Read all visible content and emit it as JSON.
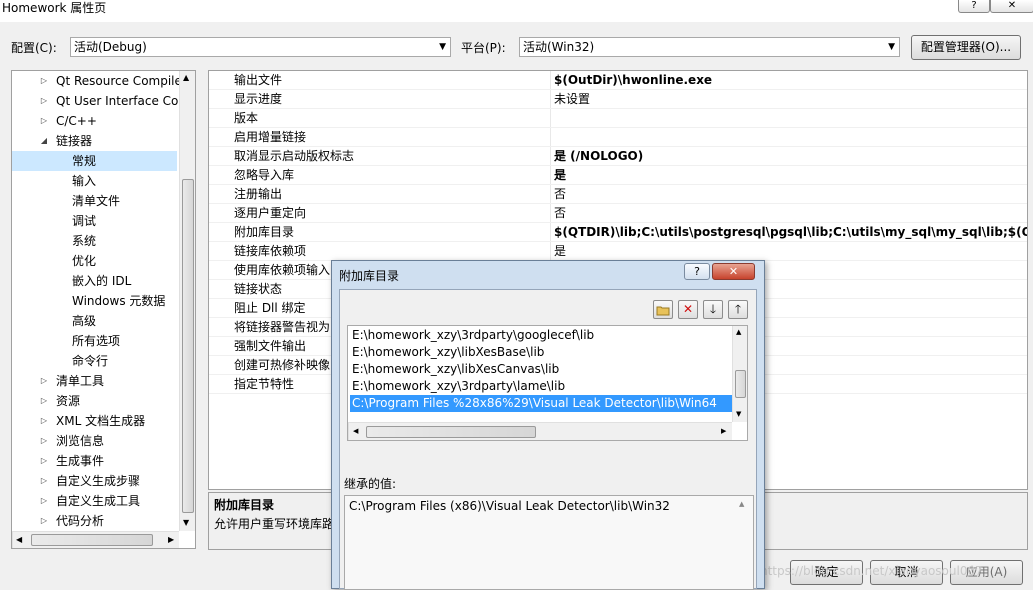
{
  "window": {
    "title": "Homework 属性页",
    "help_label": "?",
    "close_label": "✕"
  },
  "toolbar": {
    "config_label": "配置(C):",
    "config_value": "活动(Debug)",
    "platform_label": "平台(P):",
    "platform_value": "活动(Win32)",
    "config_manager_label": "配置管理器(O)..."
  },
  "tree": {
    "items": [
      {
        "label": "Qt Resource Compile",
        "expander": "▷"
      },
      {
        "label": "Qt User Interface Cor",
        "expander": "▷"
      },
      {
        "label": "C/C++",
        "expander": "▷"
      },
      {
        "label": "链接器",
        "expander": "◢"
      },
      {
        "label": "常规",
        "expander": ""
      },
      {
        "label": "输入",
        "expander": ""
      },
      {
        "label": "清单文件",
        "expander": ""
      },
      {
        "label": "调试",
        "expander": ""
      },
      {
        "label": "系统",
        "expander": ""
      },
      {
        "label": "优化",
        "expander": ""
      },
      {
        "label": "嵌入的 IDL",
        "expander": ""
      },
      {
        "label": "Windows 元数据",
        "expander": ""
      },
      {
        "label": "高级",
        "expander": ""
      },
      {
        "label": "所有选项",
        "expander": ""
      },
      {
        "label": "命令行",
        "expander": ""
      },
      {
        "label": "清单工具",
        "expander": "▷"
      },
      {
        "label": "资源",
        "expander": "▷"
      },
      {
        "label": "XML 文档生成器",
        "expander": "▷"
      },
      {
        "label": "浏览信息",
        "expander": "▷"
      },
      {
        "label": "生成事件",
        "expander": "▷"
      },
      {
        "label": "自定义生成步骤",
        "expander": "▷"
      },
      {
        "label": "自定义生成工具",
        "expander": "▷"
      },
      {
        "label": "代码分析",
        "expander": "▷"
      }
    ]
  },
  "properties": [
    {
      "name": "输出文件",
      "value": "$(OutDir)\\hwonline.exe",
      "bold": true
    },
    {
      "name": "显示进度",
      "value": "未设置",
      "bold": false
    },
    {
      "name": "版本",
      "value": "",
      "bold": false
    },
    {
      "name": "启用增量链接",
      "value": "",
      "bold": false
    },
    {
      "name": "取消显示启动版权标志",
      "value": "是 (/NOLOGO)",
      "bold": true
    },
    {
      "name": "忽略导入库",
      "value": "是",
      "bold": true
    },
    {
      "name": "注册输出",
      "value": "否",
      "bold": false
    },
    {
      "name": "逐用户重定向",
      "value": "否",
      "bold": false
    },
    {
      "name": "附加库目录",
      "value": "$(QTDIR)\\lib;C:\\utils\\postgresql\\pgsql\\lib;C:\\utils\\my_sql\\my_sql\\lib;$(QTD",
      "bold": true
    },
    {
      "name": "链接库依赖项",
      "value": "是",
      "bold": false
    },
    {
      "name": "使用库依赖项输入",
      "value": "",
      "bold": false
    },
    {
      "name": "链接状态",
      "value": "",
      "bold": false
    },
    {
      "name": "阻止 Dll 绑定",
      "value": "",
      "bold": false
    },
    {
      "name": "将链接器警告视为",
      "value": "",
      "bold": false
    },
    {
      "name": "强制文件输出",
      "value": "",
      "bold": false
    },
    {
      "name": "创建可热修补映像",
      "value": "",
      "bold": false
    },
    {
      "name": "指定节特性",
      "value": "",
      "bold": false
    }
  ],
  "description": {
    "title": "附加库目录",
    "text": "允许用户重写环境库路"
  },
  "dialog": {
    "title": "附加库目录",
    "help_label": "?",
    "close_label": "✕",
    "list_items": [
      "E:\\homework_xzy\\3rdparty\\googlecef\\lib",
      "E:\\homework_xzy\\libXesBase\\lib",
      "E:\\homework_xzy\\libXesCanvas\\lib",
      "E:\\homework_xzy\\3rdparty\\lame\\lib",
      "C:\\Program Files %28x86%29\\Visual Leak Detector\\lib\\Win64"
    ],
    "selected_index": 4,
    "inherited_label": "继承的值:",
    "inherited_items": [
      "C:\\Program Files (x86)\\Visual Leak Detector\\lib\\Win32"
    ]
  },
  "buttons": {
    "ok": "确定",
    "cancel": "取消",
    "apply": "应用(A)"
  },
  "watermark": "https://blog.csdn.net/xiaoyaosoul007"
}
